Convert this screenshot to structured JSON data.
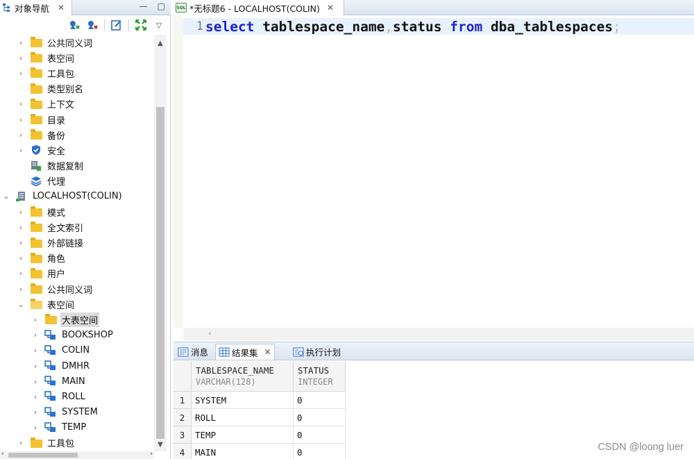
{
  "navigator": {
    "tab_title": "对象导航",
    "tab_close": "✕",
    "minimize": "—",
    "maximize": "□",
    "tree": [
      {
        "indent": 1,
        "twisty": "›",
        "icon": "folder",
        "label": "公共同义词"
      },
      {
        "indent": 1,
        "twisty": "›",
        "icon": "folder",
        "label": "表空间"
      },
      {
        "indent": 1,
        "twisty": "›",
        "icon": "folder",
        "label": "工具包"
      },
      {
        "indent": 1,
        "twisty": "",
        "icon": "folder",
        "label": "类型别名"
      },
      {
        "indent": 1,
        "twisty": "›",
        "icon": "folder",
        "label": "上下文"
      },
      {
        "indent": 1,
        "twisty": "›",
        "icon": "folder",
        "label": "目录"
      },
      {
        "indent": 1,
        "twisty": "›",
        "icon": "folder",
        "label": "备份"
      },
      {
        "indent": 1,
        "twisty": "›",
        "icon": "shield",
        "label": "安全"
      },
      {
        "indent": 1,
        "twisty": "",
        "icon": "replication",
        "label": "数据复制"
      },
      {
        "indent": 1,
        "twisty": "",
        "icon": "agent",
        "label": "代理"
      },
      {
        "indent": 0,
        "twisty": "⌄",
        "icon": "server",
        "label": "LOCALHOST(COLIN)"
      },
      {
        "indent": 1,
        "twisty": "›",
        "icon": "folder",
        "label": "模式"
      },
      {
        "indent": 1,
        "twisty": "›",
        "icon": "folder",
        "label": "全文索引"
      },
      {
        "indent": 1,
        "twisty": "›",
        "icon": "folder",
        "label": "外部链接"
      },
      {
        "indent": 1,
        "twisty": "›",
        "icon": "folder",
        "label": "角色"
      },
      {
        "indent": 1,
        "twisty": "›",
        "icon": "folder",
        "label": "用户"
      },
      {
        "indent": 1,
        "twisty": "›",
        "icon": "folder",
        "label": "公共同义词"
      },
      {
        "indent": 1,
        "twisty": "⌄",
        "icon": "folder-open",
        "label": "表空间"
      },
      {
        "indent": 2,
        "twisty": "›",
        "icon": "folder",
        "label": "大表空间",
        "selected": true
      },
      {
        "indent": 2,
        "twisty": "›",
        "icon": "tablespace",
        "label": "BOOKSHOP"
      },
      {
        "indent": 2,
        "twisty": "›",
        "icon": "tablespace",
        "label": "COLIN"
      },
      {
        "indent": 2,
        "twisty": "›",
        "icon": "tablespace",
        "label": "DMHR"
      },
      {
        "indent": 2,
        "twisty": "›",
        "icon": "tablespace",
        "label": "MAIN"
      },
      {
        "indent": 2,
        "twisty": "›",
        "icon": "tablespace",
        "label": "ROLL"
      },
      {
        "indent": 2,
        "twisty": "›",
        "icon": "tablespace",
        "label": "SYSTEM"
      },
      {
        "indent": 2,
        "twisty": "›",
        "icon": "tablespace",
        "label": "TEMP"
      },
      {
        "indent": 1,
        "twisty": "›",
        "icon": "folder",
        "label": "工具包"
      }
    ]
  },
  "editor": {
    "tab_title": "*无标题6 - LOCALHOST(COLIN)",
    "tab_badge": "SQL",
    "tab_close": "✕",
    "line_number": "1",
    "sql": [
      {
        "t": "select",
        "k": "kw"
      },
      {
        "t": " tablespace_name",
        "k": "id"
      },
      {
        "t": ",",
        "k": "pn"
      },
      {
        "t": "status ",
        "k": "id"
      },
      {
        "t": "from",
        "k": "kw"
      },
      {
        "t": " dba_tablespaces",
        "k": "id"
      },
      {
        "t": ";",
        "k": "pn"
      }
    ],
    "hscroll_left": "‹"
  },
  "results": {
    "tabs": [
      {
        "label": "消息",
        "icon": "message-icon",
        "active": false
      },
      {
        "label": "结果集",
        "icon": "grid-icon",
        "active": true,
        "close": "✕"
      },
      {
        "label": "执行计划",
        "icon": "plan-icon",
        "active": false
      }
    ],
    "columns": [
      {
        "name": "TABLESPACE_NAME",
        "type": "VARCHAR(128)"
      },
      {
        "name": "STATUS",
        "type": "INTEGER"
      }
    ],
    "rows": [
      {
        "num": "1",
        "cells": [
          "SYSTEM",
          "0"
        ]
      },
      {
        "num": "2",
        "cells": [
          "ROLL",
          "0"
        ]
      },
      {
        "num": "3",
        "cells": [
          "TEMP",
          "0"
        ]
      },
      {
        "num": "4",
        "cells": [
          "MAIN",
          "0"
        ]
      }
    ]
  },
  "watermark": "CSDN @loong luer"
}
